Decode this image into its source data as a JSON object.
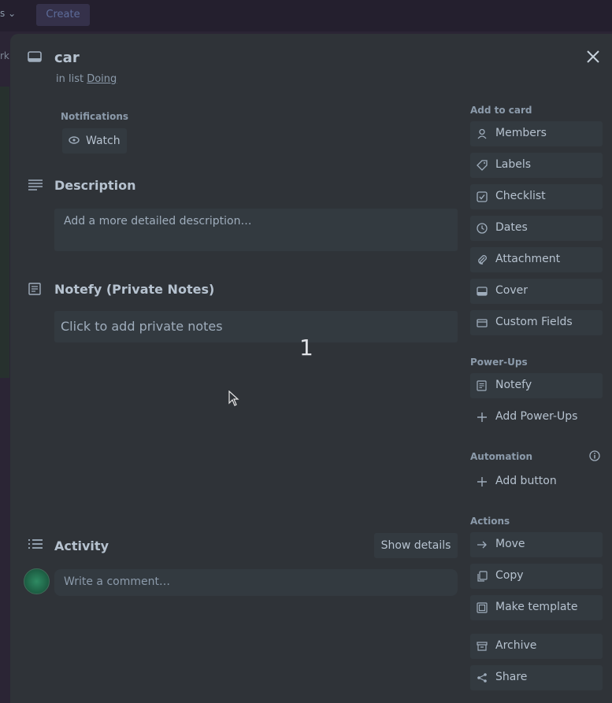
{
  "topbar": {
    "create_label": "Create",
    "left_label": "rk"
  },
  "card": {
    "title": "car",
    "in_list_prefix": "in list ",
    "list_name": "Doing"
  },
  "notifications": {
    "label": "Notifications",
    "watch_label": "Watch"
  },
  "description": {
    "title": "Description",
    "placeholder": "Add a more detailed description…"
  },
  "notefy": {
    "title": "Notefy (Private Notes)",
    "placeholder": "Click to add private notes",
    "overlay_number": "1"
  },
  "activity": {
    "title": "Activity",
    "show_details_label": "Show details",
    "comment_placeholder": "Write a comment…"
  },
  "sidebar": {
    "add_to_card_label": "Add to card",
    "add_to_card": [
      {
        "label": "Members",
        "icon": "person-icon"
      },
      {
        "label": "Labels",
        "icon": "tag-icon"
      },
      {
        "label": "Checklist",
        "icon": "checkbox-icon"
      },
      {
        "label": "Dates",
        "icon": "clock-icon"
      },
      {
        "label": "Attachment",
        "icon": "paperclip-icon"
      },
      {
        "label": "Cover",
        "icon": "cover-icon"
      },
      {
        "label": "Custom Fields",
        "icon": "custom-fields-icon"
      }
    ],
    "powerups_label": "Power-Ups",
    "powerups": [
      {
        "label": "Notefy",
        "icon": "notefy-icon"
      },
      {
        "label": "Add Power-Ups",
        "icon": "plus-icon"
      }
    ],
    "automation_label": "Automation",
    "automation": [
      {
        "label": "Add button",
        "icon": "plus-icon"
      }
    ],
    "actions_label": "Actions",
    "actions": [
      {
        "label": "Move",
        "icon": "arrow-right-icon"
      },
      {
        "label": "Copy",
        "icon": "copy-icon"
      },
      {
        "label": "Make template",
        "icon": "template-icon"
      },
      {
        "label": "Archive",
        "icon": "archive-icon"
      },
      {
        "label": "Share",
        "icon": "share-icon"
      }
    ]
  },
  "colors": {
    "page_bg": "#2b2535",
    "modal_bg": "#2f3338",
    "button_bg": "#333a40",
    "text": "#b6c2cf"
  }
}
